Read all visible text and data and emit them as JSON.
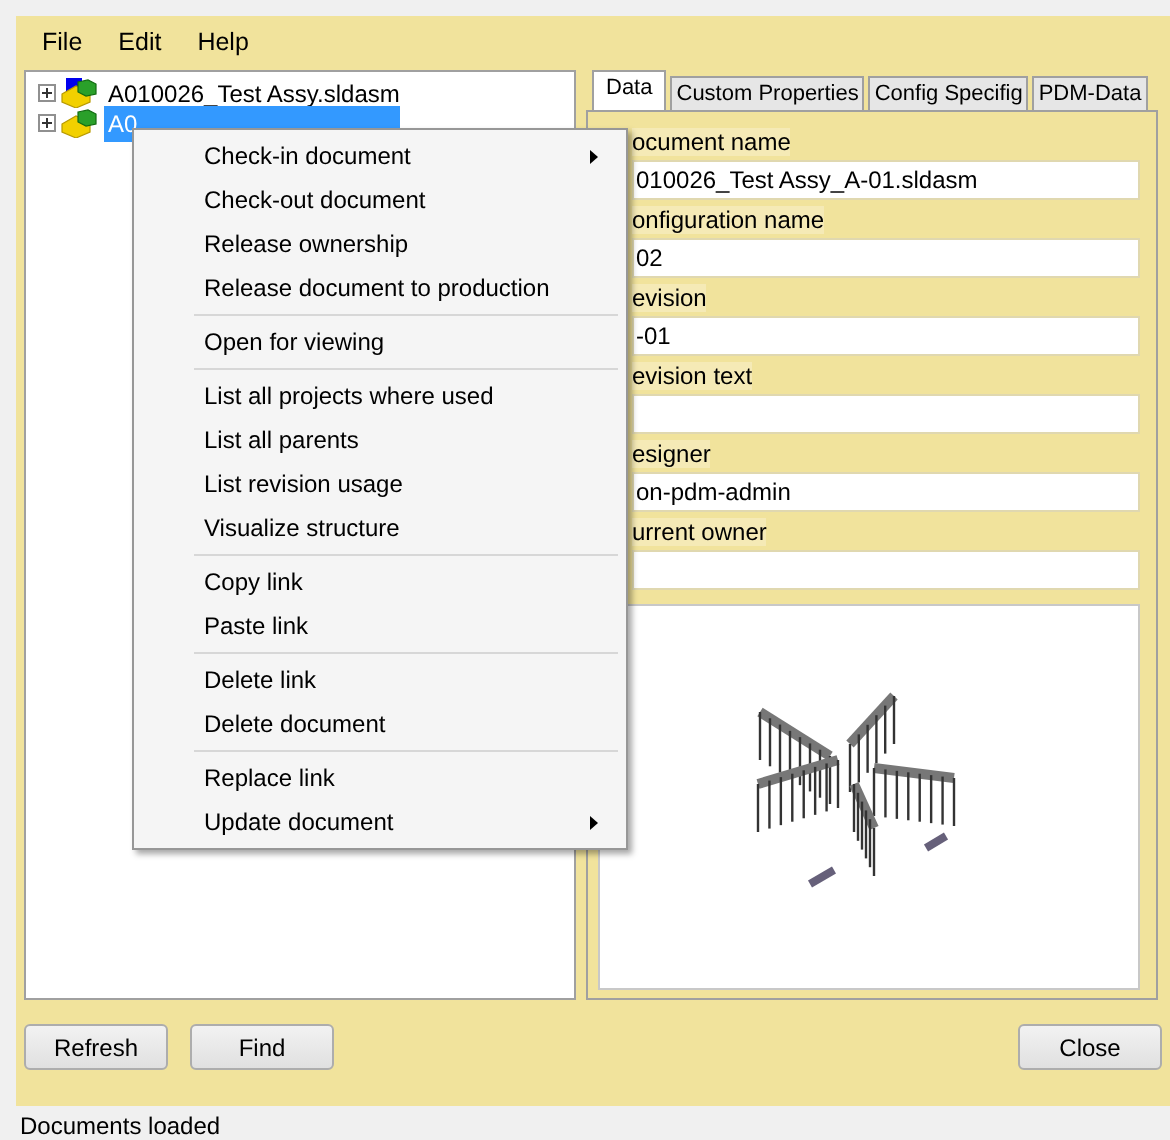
{
  "menu_bar": [
    "File",
    "Edit",
    "Help"
  ],
  "tree": [
    {
      "label": "A010026_Test Assy.sldasm",
      "selected": false,
      "expanded": false
    },
    {
      "label": "A0",
      "selected": true,
      "expanded": false
    }
  ],
  "tabs": [
    {
      "label": "Data",
      "selected": true
    },
    {
      "label": "Custom Properties",
      "selected": false
    },
    {
      "label": "Config Specifig",
      "selected": false
    },
    {
      "label": "PDM-Data",
      "selected": false
    }
  ],
  "fields": [
    {
      "label": "ocument name",
      "value": "010026_Test Assy_A-01.sldasm"
    },
    {
      "label": "onfiguration name",
      "value": "02"
    },
    {
      "label": "evision",
      "value": "-01"
    },
    {
      "label": "evision text"
    },
    {
      "label": "esigner",
      "value": "on-pdm-admin"
    },
    {
      "label": "urrent owner"
    }
  ],
  "context_menu": [
    [
      {
        "label": "Check-in document",
        "has_submenu": true
      },
      {
        "label": "Check-out document",
        "has_submenu": false
      },
      {
        "label": "Release ownership",
        "has_submenu": false
      },
      {
        "label": "Release document to production",
        "has_submenu": false
      }
    ],
    [
      {
        "label": "Open for viewing",
        "has_submenu": false
      }
    ],
    [
      {
        "label": "List all projects where used",
        "has_submenu": false
      },
      {
        "label": "List all parents",
        "has_submenu": false
      },
      {
        "label": "List revision usage",
        "has_submenu": false
      },
      {
        "label": "Visualize structure",
        "has_submenu": false
      }
    ],
    [
      {
        "label": "Copy link",
        "has_submenu": false
      },
      {
        "label": "Paste link",
        "has_submenu": false
      }
    ],
    [
      {
        "label": "Delete link",
        "has_submenu": false
      },
      {
        "label": "Delete document",
        "has_submenu": false
      }
    ],
    [
      {
        "label": "Replace link",
        "has_submenu": false
      },
      {
        "label": "Update document",
        "has_submenu": true
      }
    ]
  ],
  "buttons": [
    "Refresh",
    "Find"
  ],
  "close_button": "Close",
  "status_bar": "Documents loaded"
}
